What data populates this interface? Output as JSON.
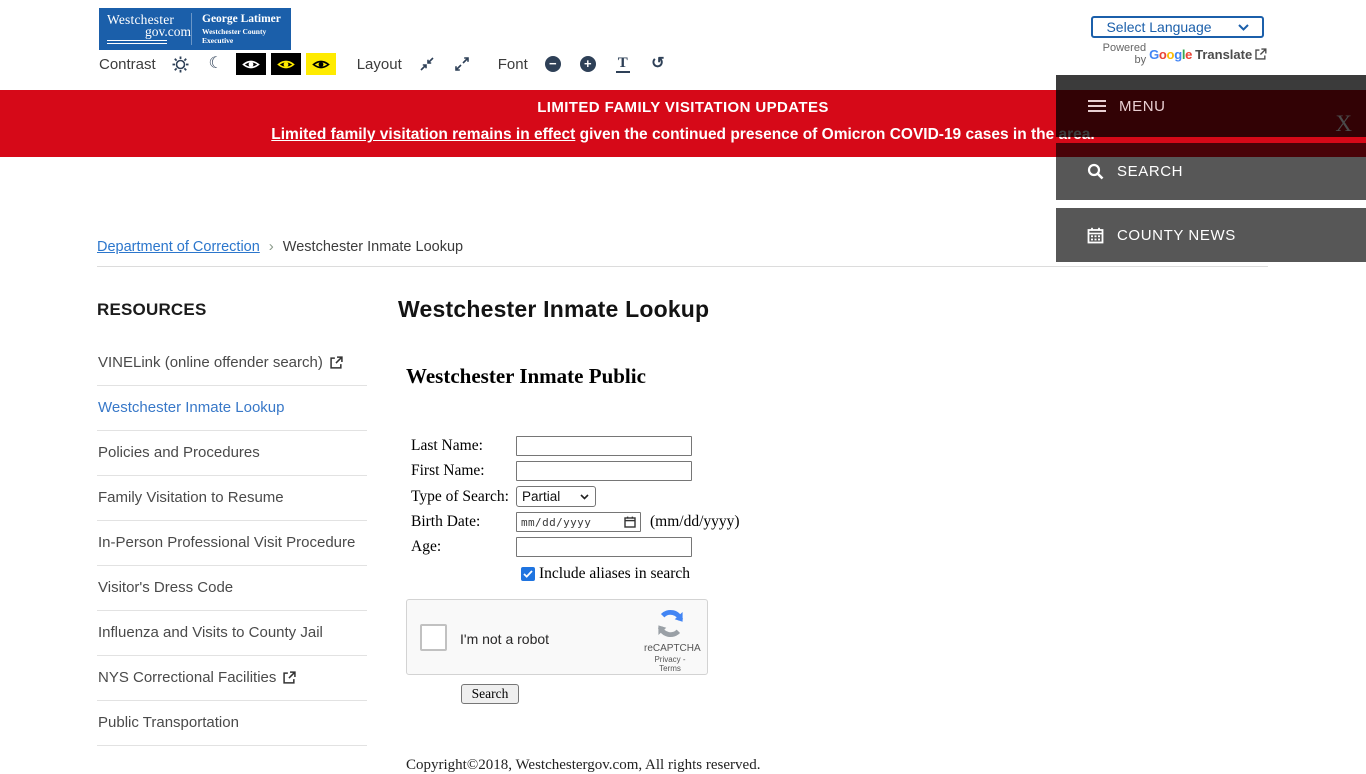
{
  "header": {
    "logo": {
      "brand_line1": "Westchester",
      "brand_line2": "gov.com",
      "executive_name": "George Latimer",
      "executive_title": "Westchester County Executive"
    },
    "toolbar": {
      "contrast_label": "Contrast",
      "layout_label": "Layout",
      "font_label": "Font"
    },
    "translate": {
      "select_label": "Select Language",
      "powered_by": "Powered by",
      "google_letters": [
        "G",
        "o",
        "o",
        "g",
        "l",
        "e"
      ],
      "translate_word": "Translate"
    }
  },
  "icons": {
    "moon": "☾",
    "font_minus": "−",
    "font_plus": "+",
    "font_resize": "T",
    "font_reset": "↺"
  },
  "alert_banner": {
    "background": "#d60918",
    "title": "LIMITED FAMILY VISITATION UPDATES",
    "link_text": "Limited family visitation remains in effect",
    "rest_text": " given the continued presence of Omicron COVID-19 cases in the area."
  },
  "side_menu": {
    "menu_label": "MENU",
    "close_label": "X",
    "search_label": "SEARCH",
    "news_label": "COUNTY NEWS"
  },
  "breadcrumb": {
    "parent": "Department of Correction",
    "separator": "›",
    "current": "Westchester Inmate Lookup"
  },
  "sidebar": {
    "heading": "RESOURCES",
    "items": [
      {
        "label": "VINELink (online offender search)",
        "external": true,
        "active": false
      },
      {
        "label": "Westchester Inmate Lookup",
        "external": false,
        "active": true
      },
      {
        "label": "Policies and Procedures",
        "external": false,
        "active": false
      },
      {
        "label": "Family Visitation to Resume",
        "external": false,
        "active": false
      },
      {
        "label": "In-Person Professional Visit Procedure",
        "external": false,
        "active": false
      },
      {
        "label": "Visitor's Dress Code",
        "external": false,
        "active": false
      },
      {
        "label": "Influenza and Visits to County Jail",
        "external": false,
        "active": false
      },
      {
        "label": "NYS Correctional Facilities",
        "external": true,
        "active": false
      },
      {
        "label": "Public Transportation",
        "external": false,
        "active": false
      }
    ]
  },
  "main": {
    "page_title": "Westchester Inmate Lookup",
    "form_title": "Westchester Inmate Public",
    "form": {
      "last_name_label": "Last Name:",
      "last_name_value": "",
      "first_name_label": "First Name:",
      "first_name_value": "",
      "type_label": "Type of Search:",
      "type_selected": "Partial",
      "birth_label": "Birth Date:",
      "birth_placeholder": "mm/dd/yyyy",
      "birth_hint": "(mm/dd/yyyy)",
      "age_label": "Age:",
      "age_value": "",
      "aliases_label": "Include aliases in search",
      "search_button_label": "Search"
    },
    "recaptcha": {
      "checkbox_label": "I'm not a robot",
      "brand": "reCAPTCHA",
      "links": "Privacy - Terms"
    },
    "copyright": "Copyright©2018, Westchestergov.com, All rights reserved."
  }
}
